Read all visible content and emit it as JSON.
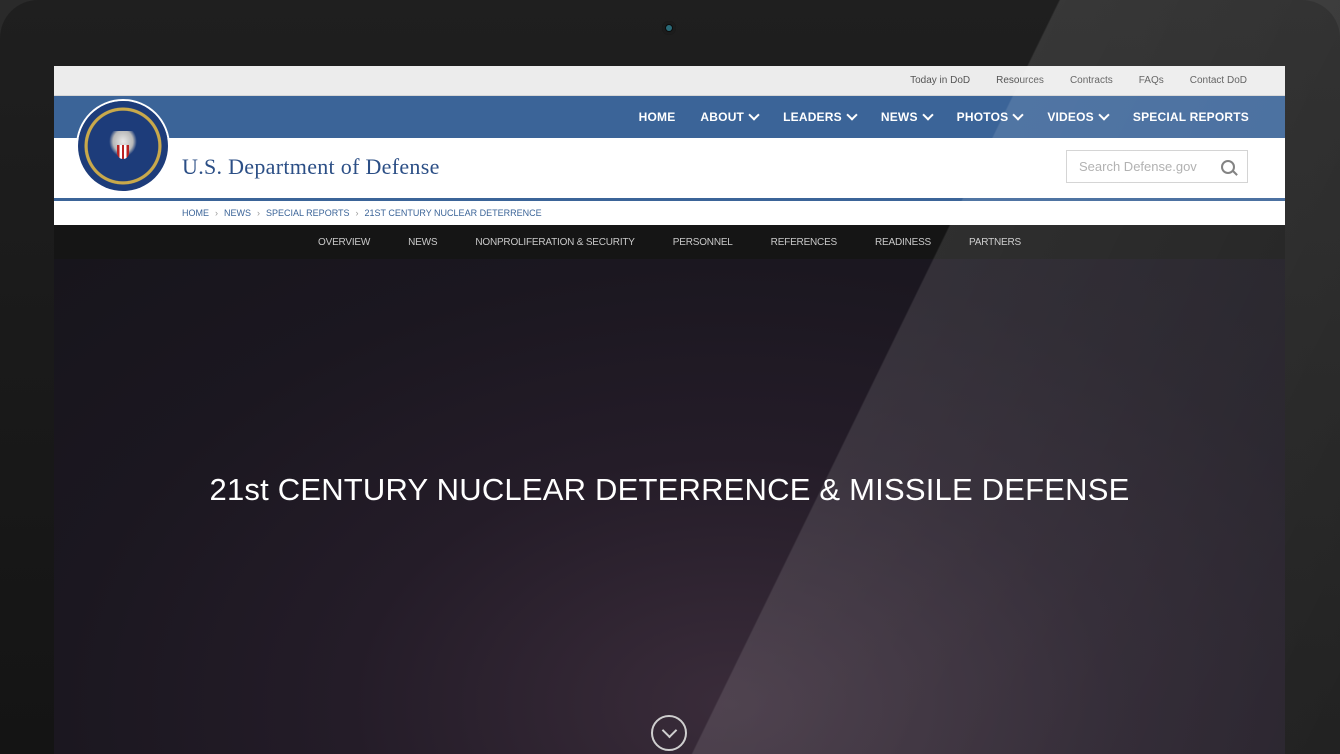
{
  "utility_links": [
    "Today in DoD",
    "Resources",
    "Contracts",
    "FAQs",
    "Contact DoD"
  ],
  "main_nav": [
    {
      "label": "HOME",
      "has_dropdown": false
    },
    {
      "label": "ABOUT",
      "has_dropdown": true
    },
    {
      "label": "LEADERS",
      "has_dropdown": true
    },
    {
      "label": "NEWS",
      "has_dropdown": true
    },
    {
      "label": "PHOTOS",
      "has_dropdown": true
    },
    {
      "label": "VIDEOS",
      "has_dropdown": true
    },
    {
      "label": "SPECIAL REPORTS",
      "has_dropdown": false
    }
  ],
  "brand": {
    "name": "U.S. Department of Defense"
  },
  "search": {
    "placeholder": "Search Defense.gov",
    "value": ""
  },
  "breadcrumb": [
    "HOME",
    "NEWS",
    "SPECIAL REPORTS",
    "21ST CENTURY NUCLEAR DETERRENCE"
  ],
  "sub_nav": [
    "OVERVIEW",
    "NEWS",
    "NONPROLIFERATION & SECURITY",
    "PERSONNEL",
    "REFERENCES",
    "READINESS",
    "PARTNERS"
  ],
  "hero": {
    "title": "21st CENTURY NUCLEAR DETERRENCE & MISSILE DEFENSE"
  },
  "colors": {
    "nav_blue": "#3b6498",
    "subnav_bg": "#151515",
    "hero_bg": "#1b1720"
  }
}
